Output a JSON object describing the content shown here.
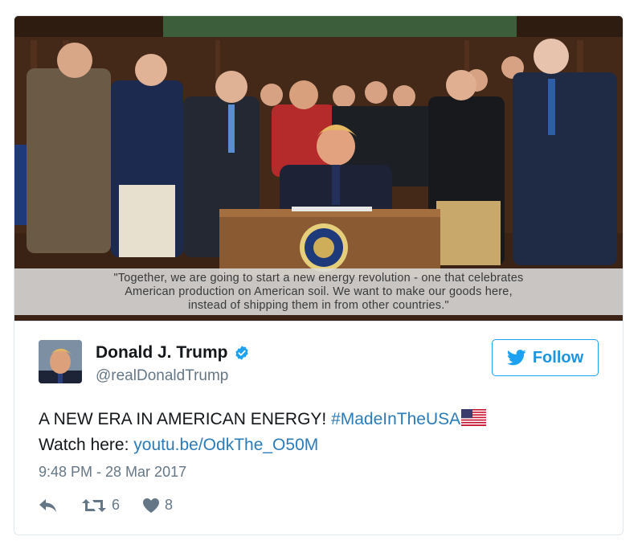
{
  "media": {
    "quote_lines": [
      "\"Together, we are going to start a new energy revolution - one that celebrates",
      "American production on American soil.  We want to make our goods here,",
      "instead of shipping them in from other countries.\""
    ]
  },
  "author": {
    "name": "Donald J. Trump",
    "handle": "@realDonaldTrump",
    "verified": true,
    "avatar_icon": "profile-photo"
  },
  "follow_button": {
    "label": "Follow",
    "icon": "twitter-bird-icon"
  },
  "tweet": {
    "text_line1": "A NEW ERA IN AMERICAN ENERGY! ",
    "hashtag": "#MadeInTheUSA",
    "emoji": "us-flag-icon",
    "text_line2": "Watch here: ",
    "link": "youtu.be/OdkThe_O50M"
  },
  "timestamp": "9:48 PM - 28 Mar 2017",
  "actions": {
    "reply_icon": "reply-icon",
    "retweet_icon": "retweet-icon",
    "retweet_count": "6",
    "like_icon": "heart-icon",
    "like_count": "8"
  },
  "colors": {
    "accent": "#1da1f2",
    "link": "#2b7bb9",
    "secondary_text": "#657786",
    "border": "#e1e8ed"
  }
}
